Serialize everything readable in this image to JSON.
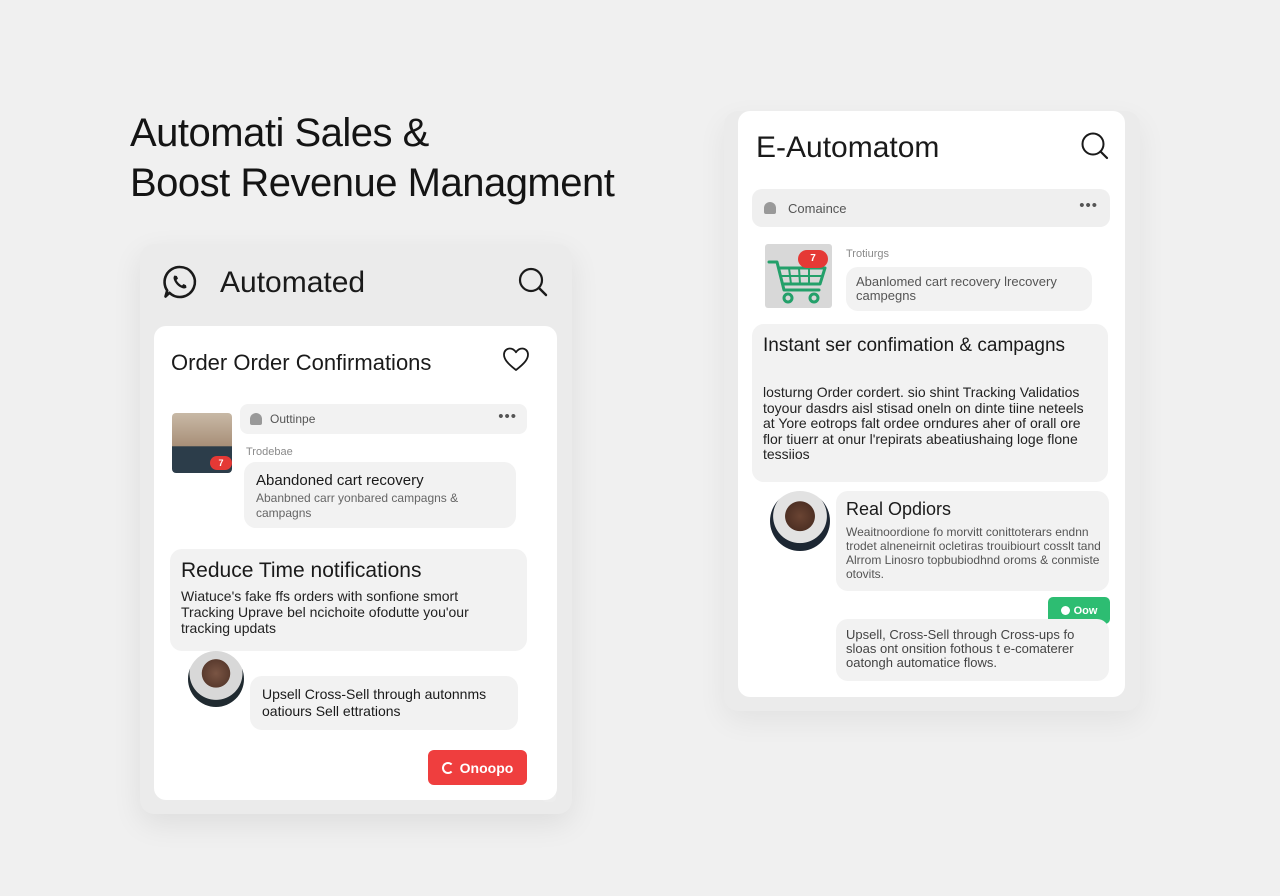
{
  "headline": {
    "line1": "Automati Sales &",
    "line2": "Boost Revenue Managment"
  },
  "left_app": {
    "title": "Automated",
    "card_title": "Order Order Confirmations",
    "thread_label": "Outtinpe",
    "small_label": "Trodebae",
    "badge_count": "7",
    "bubble1_title": "Abandoned cart recovery",
    "bubble1_sub": "Abanbned carr yonbared campagns & campagns",
    "reduce_title": "Reduce Time notifications",
    "reduce_desc": "Wiatuce's fake ffs orders with sonfione smort Tracking Uprave bel ncichoite ofodutte you'our tracking updats",
    "bubble2_text": "Upsell Cross-Sell through autonnms oatiours Sell ettrations",
    "button_label": "Onoopo",
    "accent_color": "#ef3e3e"
  },
  "right_app": {
    "title": "E-Automatom",
    "thread_label": "Comaince",
    "badge_count": "7",
    "small_label": "Trotiurgs",
    "bubble_text": "Abanlomed cart recovery lrecovery campegns",
    "instant_title": "Instant ser confimation & campagns",
    "instant_desc": "losturng Order cordert. sio shint Tracking Validatios toyour dasdrs aisl stisad oneln on dinte tiine neteels at Yore eotrops falt ordee orndures aher of orall ore flor tiuerr at onur l'repirats abeatiushaing loge flone tessiios",
    "real_title": "Real Opdiors",
    "real_desc": "Weaitnoordione fo morvitt conittoterars endnn trodet alneneirnit ocletiras trouibiourt cosslt tand Alrrom Linosro topbubiodhnd oroms & conmiste otovits.",
    "button_label": "Oow",
    "bubble2_text": "Upsell, Cross-Sell through Cross-ups fo sloas ont onsition fothous t e-comaterer oatongh automatice flows.",
    "accent_color": "#2dbd72"
  }
}
